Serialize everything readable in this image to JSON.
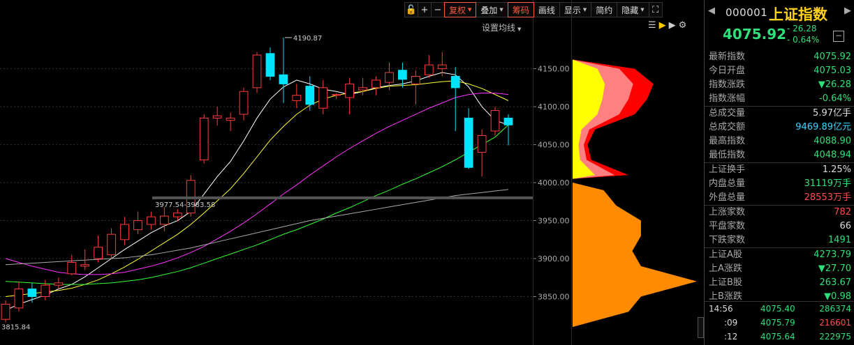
{
  "toolbar": {
    "items": [
      {
        "label": "",
        "icon": "lock-icon"
      },
      {
        "label": "+",
        "icon": ""
      },
      {
        "label": "−",
        "icon": ""
      },
      {
        "label": "复权",
        "active": true,
        "dropdown": true
      },
      {
        "label": "叠加",
        "active": false,
        "dropdown": true
      },
      {
        "label": "筹码",
        "active": true,
        "dropdown": false
      },
      {
        "label": "画线",
        "active": false,
        "dropdown": false
      },
      {
        "label": "显示",
        "active": false,
        "dropdown": true
      },
      {
        "label": "简约",
        "active": false,
        "dropdown": false
      },
      {
        "label": "隐藏",
        "active": false,
        "dropdown": true
      }
    ],
    "ma_settings_label": "设置均线"
  },
  "chart_data": {
    "type": "candlestick",
    "ylim": [
      3800,
      4190
    ],
    "y_ticks": [
      3850,
      3900,
      3950,
      4000,
      4050,
      4100,
      4150
    ],
    "y_tick_labels": [
      "3850.00",
      "3900.00",
      "3950.00",
      "4000.00",
      "4050.00",
      "4100.00",
      "4150.00"
    ],
    "annotations": {
      "high_label": "4190.87",
      "low_label": "3815.84",
      "chip_range_label": "3977.54-3983.58"
    },
    "colors": {
      "up": "#ff3b3b",
      "down": "#00e5ff",
      "ma5": "#ffffff",
      "ma10": "#ffff33",
      "ma20": "#ff33ff",
      "ma60": "#33ff33",
      "ma120": "#aaaaaa"
    },
    "candles": [
      {
        "o": 3820,
        "c": 3840,
        "h": 3845,
        "l": 3816
      },
      {
        "o": 3835,
        "c": 3860,
        "h": 3870,
        "l": 3830
      },
      {
        "o": 3860,
        "c": 3850,
        "h": 3868,
        "l": 3842
      },
      {
        "o": 3850,
        "c": 3865,
        "h": 3872,
        "l": 3845
      },
      {
        "o": 3865,
        "c": 3868,
        "h": 3875,
        "l": 3860
      },
      {
        "o": 3880,
        "c": 3895,
        "h": 3905,
        "l": 3878
      },
      {
        "o": 3890,
        "c": 3892,
        "h": 3912,
        "l": 3885
      },
      {
        "o": 3900,
        "c": 3915,
        "h": 3930,
        "l": 3895
      },
      {
        "o": 3905,
        "c": 3932,
        "h": 3940,
        "l": 3900
      },
      {
        "o": 3925,
        "c": 3945,
        "h": 3955,
        "l": 3918
      },
      {
        "o": 3938,
        "c": 3950,
        "h": 3962,
        "l": 3932
      },
      {
        "o": 3945,
        "c": 3955,
        "h": 3962,
        "l": 3938
      },
      {
        "o": 3945,
        "c": 3956,
        "h": 3968,
        "l": 3936
      },
      {
        "o": 3955,
        "c": 3960,
        "h": 3965,
        "l": 3950
      },
      {
        "o": 3960,
        "c": 4003,
        "h": 4010,
        "l": 3955
      },
      {
        "o": 4030,
        "c": 4085,
        "h": 4090,
        "l": 4025
      },
      {
        "o": 4085,
        "c": 4088,
        "h": 4100,
        "l": 4075
      },
      {
        "o": 4082,
        "c": 4085,
        "h": 4092,
        "l": 4068
      },
      {
        "o": 4090,
        "c": 4120,
        "h": 4125,
        "l": 4082
      },
      {
        "o": 4125,
        "c": 4168,
        "h": 4172,
        "l": 4118
      },
      {
        "o": 4170,
        "c": 4140,
        "h": 4178,
        "l": 4135
      },
      {
        "o": 4142,
        "c": 4130,
        "h": 4191,
        "l": 4105
      },
      {
        "o": 4108,
        "c": 4115,
        "h": 4130,
        "l": 4098
      },
      {
        "o": 4127,
        "c": 4103,
        "h": 4140,
        "l": 4095
      },
      {
        "o": 4098,
        "c": 4125,
        "h": 4135,
        "l": 4090
      },
      {
        "o": 4115,
        "c": 4116,
        "h": 4118,
        "l": 4110
      },
      {
        "o": 4112,
        "c": 4130,
        "h": 4138,
        "l": 4090
      },
      {
        "o": 4122,
        "c": 4125,
        "h": 4138,
        "l": 4115
      },
      {
        "o": 4125,
        "c": 4135,
        "h": 4140,
        "l": 4115
      },
      {
        "o": 4132,
        "c": 4145,
        "h": 4158,
        "l": 4122
      },
      {
        "o": 4148,
        "c": 4136,
        "h": 4158,
        "l": 4125
      },
      {
        "o": 4130,
        "c": 4140,
        "h": 4148,
        "l": 4103
      },
      {
        "o": 4142,
        "c": 4155,
        "h": 4168,
        "l": 4138
      },
      {
        "o": 4150,
        "c": 4155,
        "h": 4172,
        "l": 4140
      },
      {
        "o": 4140,
        "c": 4125,
        "h": 4152,
        "l": 4068
      },
      {
        "o": 4085,
        "c": 4020,
        "h": 4098,
        "l": 4018
      },
      {
        "o": 4040,
        "c": 4062,
        "h": 4070,
        "l": 4008
      },
      {
        "o": 4068,
        "c": 4095,
        "h": 4100,
        "l": 4062
      },
      {
        "o": 4085,
        "c": 4076,
        "h": 4090,
        "l": 4049
      }
    ],
    "ma_lines": [
      {
        "name": "ma5",
        "values": [
          3832,
          3840,
          3846,
          3852,
          3860,
          3866,
          3876,
          3888,
          3900,
          3912,
          3923,
          3934,
          3943,
          3950,
          3962,
          3985,
          4008,
          4028,
          4055,
          4085,
          4110,
          4126,
          4135,
          4130,
          4123,
          4120,
          4116,
          4120,
          4125,
          4128,
          4130,
          4134,
          4140,
          4145,
          4142,
          4126,
          4100,
          4082,
          4076
        ]
      },
      {
        "name": "ma10",
        "values": [
          3850,
          3852,
          3854,
          3856,
          3858,
          3861,
          3866,
          3872,
          3880,
          3889,
          3899,
          3910,
          3921,
          3932,
          3945,
          3960,
          3976,
          3992,
          4012,
          4034,
          4056,
          4074,
          4090,
          4102,
          4110,
          4115,
          4118,
          4120,
          4124,
          4127,
          4128,
          4129,
          4131,
          4133,
          4134,
          4130,
          4124,
          4116,
          4108
        ]
      },
      {
        "name": "ma20",
        "values": [
          3900,
          3895,
          3890,
          3886,
          3882,
          3880,
          3879,
          3879,
          3880,
          3882,
          3886,
          3890,
          3895,
          3901,
          3908,
          3916,
          3926,
          3936,
          3947,
          3959,
          3972,
          3985,
          3997,
          4010,
          4022,
          4034,
          4045,
          4055,
          4065,
          4074,
          4082,
          4090,
          4098,
          4105,
          4112,
          4116,
          4118,
          4118,
          4116
        ]
      },
      {
        "name": "ma60",
        "values": [
          3870,
          3869,
          3868,
          3867,
          3866,
          3866,
          3866,
          3867,
          3868,
          3870,
          3872,
          3875,
          3879,
          3883,
          3888,
          3894,
          3900,
          3906,
          3912,
          3918,
          3925,
          3932,
          3938,
          3945,
          3952,
          3960,
          3967,
          3975,
          3983,
          3990,
          3998,
          4005,
          4013,
          4021,
          4030,
          4040,
          4050,
          4060,
          4076
        ]
      },
      {
        "name": "ma120",
        "values": [
          3892,
          3893,
          3894,
          3895,
          3896,
          3897,
          3898,
          3899,
          3900,
          3901,
          3903,
          3905,
          3908,
          3911,
          3914,
          3918,
          3922,
          3926,
          3930,
          3934,
          3938,
          3942,
          3946,
          3950,
          3953,
          3956,
          3959,
          3962,
          3965,
          3968,
          3971,
          3974,
          3977,
          3980,
          3983,
          3985,
          3987,
          3989,
          3991
        ]
      }
    ],
    "chip_distribution": {
      "price_levels": [
        3830,
        3850,
        3870,
        3890,
        3910,
        3930,
        3950,
        3970,
        3990,
        4010,
        4030,
        4050,
        4070,
        4090,
        4110,
        4130,
        4150
      ],
      "widths": [
        0.45,
        0.55,
        1.0,
        0.55,
        0.48,
        0.55,
        0.55,
        0.35,
        0.25,
        0.45,
        0.15,
        0.12,
        0.18,
        0.5,
        0.6,
        0.65,
        0.5
      ]
    }
  },
  "panel": {
    "code": "000001",
    "name": "上证指数",
    "price": "4075.92",
    "change": "- 26.28",
    "change_pct": "- 0.64%",
    "rows": [
      {
        "label": "最新指数",
        "value": "4075.92",
        "color": "g"
      },
      {
        "label": "今日开盘",
        "value": "4075.03",
        "color": "g"
      },
      {
        "label": "指数涨跌",
        "value": "▼26.28",
        "color": "g"
      },
      {
        "label": "指数涨幅",
        "value": "-0.64%",
        "color": "g"
      },
      {
        "label": "总成交量",
        "value": "5.97亿手",
        "color": "w"
      },
      {
        "label": "总成交额",
        "value": "9469.89亿元",
        "color": "c"
      },
      {
        "label": "最高指数",
        "value": "4088.90",
        "color": "g"
      },
      {
        "label": "最低指数",
        "value": "4048.94",
        "color": "g"
      },
      {
        "label": "上证换手",
        "value": "1.25%",
        "color": "w"
      },
      {
        "label": "内盘总量",
        "value": "31119万手",
        "color": "g"
      },
      {
        "label": "外盘总量",
        "value": "28553万手",
        "color": "r"
      },
      {
        "label": "上涨家数",
        "value": "782",
        "color": "r"
      },
      {
        "label": "平盘家数",
        "value": "66",
        "color": "w"
      },
      {
        "label": "下跌家数",
        "value": "1491",
        "color": "g"
      },
      {
        "label": "上证A股",
        "value": "4273.79",
        "color": "g"
      },
      {
        "label": "上A涨跌",
        "value": "▼27.70",
        "color": "g"
      },
      {
        "label": "上证B股",
        "value": "263.67",
        "color": "g"
      },
      {
        "label": "上B涨跌",
        "value": "▼0.98",
        "color": "g"
      }
    ],
    "ticks": [
      {
        "time": "14:56",
        "price": "4075.40",
        "vol": "286374",
        "vcolor": "g"
      },
      {
        "time": ":09",
        "price": "4075.79",
        "vol": "216601",
        "vcolor": "r"
      },
      {
        "time": ":12",
        "price": "4075.64",
        "vol": "222975",
        "vcolor": "g"
      }
    ]
  }
}
